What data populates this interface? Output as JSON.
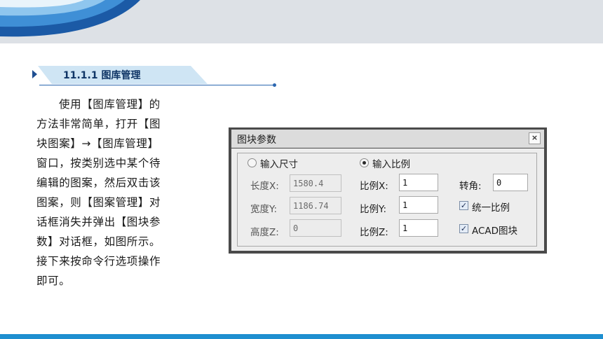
{
  "colors": {
    "accent": "#1e8fd0",
    "heading_text": "#0f3566",
    "heading_tab": "#cfe5f4"
  },
  "section": {
    "title": "11.1.1 图库管理"
  },
  "paragraph": {
    "lines": [
      "使用【图库管理】的",
      "方法非常简单，打开【图",
      "块图案】→【图库管理】",
      "窗口，按类别选中某个待",
      "编辑的图案，然后双击该",
      "图案，则【图案管理】对",
      "话框消失并弹出【图块参",
      "数】对话框，如图所示。",
      "接下来按命令行选项操作",
      "即可。"
    ]
  },
  "dialog": {
    "title": "图块参数",
    "close_icon": "close-icon",
    "radio_size": {
      "label": "输入尺寸",
      "checked": false
    },
    "radio_scale": {
      "label": "输入比例",
      "checked": true
    },
    "length": {
      "label": "长度X:",
      "value": "1580.4"
    },
    "width": {
      "label": "宽度Y:",
      "value": "1186.74"
    },
    "height": {
      "label": "高度Z:",
      "value": "0"
    },
    "scale_x": {
      "label": "比例X:",
      "value": "1"
    },
    "scale_y": {
      "label": "比例Y:",
      "value": "1"
    },
    "scale_z": {
      "label": "比例Z:",
      "value": "1"
    },
    "rotation": {
      "label": "转角:",
      "value": "0"
    },
    "uniform_scale": {
      "label": "统一比例",
      "checked": true
    },
    "acad_block": {
      "label": "ACAD图块",
      "checked": true
    }
  }
}
